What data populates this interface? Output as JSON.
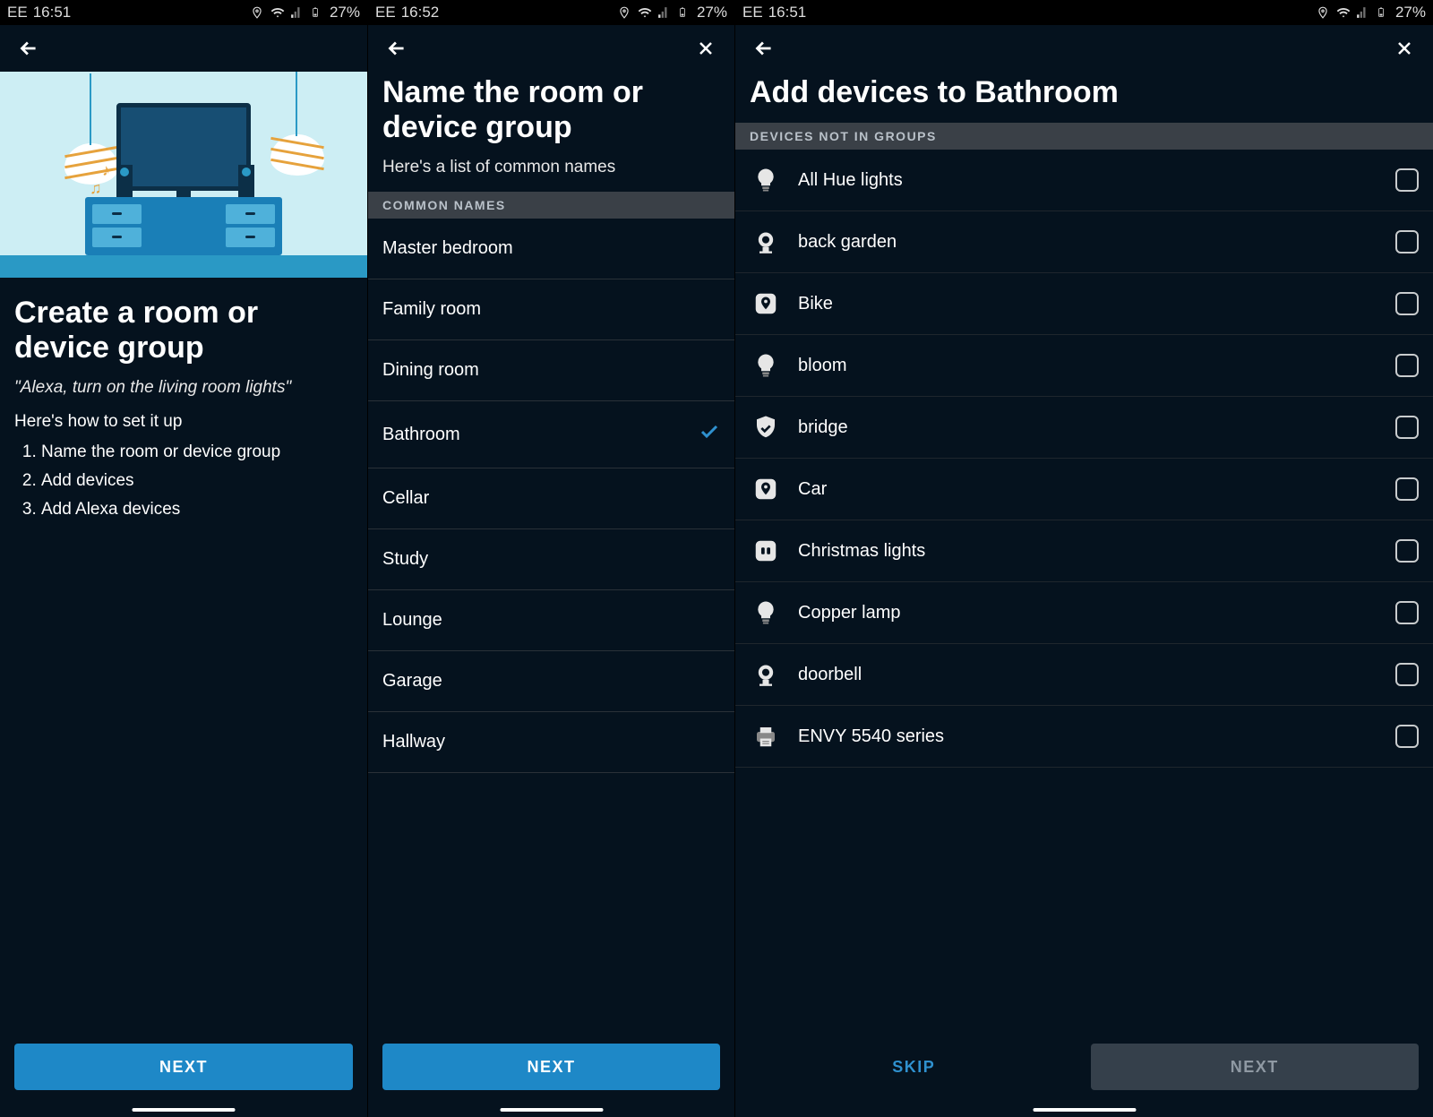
{
  "statusbar": {
    "carrier": "EE",
    "battery_pct": "27%"
  },
  "screen1": {
    "time": "16:51",
    "title": "Create a room or device group",
    "quote": "\"Alexa, turn on the living room lights\"",
    "subhead": "Here's how to set it up",
    "steps": [
      "Name the room or device group",
      "Add devices",
      "Add Alexa devices"
    ],
    "next_label": "NEXT"
  },
  "screen2": {
    "time": "16:52",
    "title": "Name the room or device group",
    "subtitle": "Here's a list of common names",
    "section_header": "COMMON NAMES",
    "selected": "Bathroom",
    "names": [
      "Master bedroom",
      "Family room",
      "Dining room",
      "Bathroom",
      "Cellar",
      "Study",
      "Lounge",
      "Garage",
      "Hallway"
    ],
    "next_label": "NEXT"
  },
  "screen3": {
    "time": "16:51",
    "title": "Add devices to Bathroom",
    "section_header": "DEVICES NOT IN GROUPS",
    "devices": [
      {
        "name": "All Hue lights",
        "icon": "bulb"
      },
      {
        "name": "back garden",
        "icon": "camera"
      },
      {
        "name": "Bike",
        "icon": "tile"
      },
      {
        "name": "bloom",
        "icon": "bulb"
      },
      {
        "name": "bridge",
        "icon": "shield"
      },
      {
        "name": "Car",
        "icon": "tile"
      },
      {
        "name": "Christmas lights",
        "icon": "plug"
      },
      {
        "name": "Copper lamp",
        "icon": "bulb"
      },
      {
        "name": "doorbell",
        "icon": "camera"
      },
      {
        "name": "ENVY 5540 series",
        "icon": "printer"
      }
    ],
    "skip_label": "SKIP",
    "next_label": "NEXT"
  }
}
